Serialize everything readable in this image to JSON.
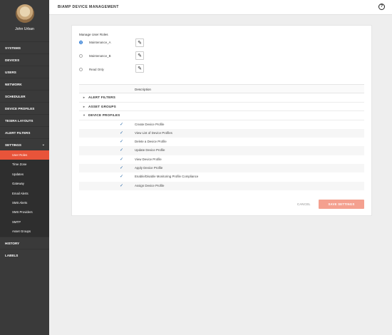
{
  "user": {
    "name": "John Urban"
  },
  "header": {
    "title": "BIAMP DEVICE MANAGEMENT",
    "help_glyph": "?"
  },
  "sidebar": {
    "items": [
      {
        "label": "SYSTEMS"
      },
      {
        "label": "DEVICES"
      },
      {
        "label": "USERS"
      },
      {
        "label": "NETWORK"
      },
      {
        "label": "SCHEDULER"
      },
      {
        "label": "DEVICE PROFILES"
      },
      {
        "label": "TESIRA LAYOUTS"
      },
      {
        "label": "ALERT FILTERS"
      },
      {
        "label": "SETTINGS",
        "expanded": true
      }
    ],
    "settings_sub": [
      {
        "label": "User Roles",
        "active": true
      },
      {
        "label": "Time Zone"
      },
      {
        "label": "Updates"
      },
      {
        "label": "Gateway"
      },
      {
        "label": "Email Alerts"
      },
      {
        "label": "SMS Alerts"
      },
      {
        "label": "SMS Providers"
      },
      {
        "label": "SMTP"
      },
      {
        "label": "Asset Groups"
      }
    ],
    "bottom_items": [
      {
        "label": "HISTORY"
      },
      {
        "label": "LABELS"
      }
    ]
  },
  "roles": {
    "title": "Manage User Roles",
    "items": [
      {
        "label": "Maintenance_A",
        "selected": true
      },
      {
        "label": "Maintenance_B",
        "selected": false
      },
      {
        "label": "Read Only",
        "selected": false
      }
    ]
  },
  "permissions": {
    "description_header": "Description",
    "groups": [
      {
        "label": "ALERT FILTERS",
        "expanded": false
      },
      {
        "label": "ASSET GROUPS",
        "expanded": false
      },
      {
        "label": "DEVICE PROFILES",
        "expanded": true
      }
    ],
    "rows": [
      {
        "label": "Create Device Profile",
        "checked": true
      },
      {
        "label": "View List of Device Profiles",
        "checked": true
      },
      {
        "label": "Delete a Device Profile",
        "checked": true
      },
      {
        "label": "Update Device Profile",
        "checked": true
      },
      {
        "label": "View Device Profile",
        "checked": true
      },
      {
        "label": "Apply Device Profile",
        "checked": true
      },
      {
        "label": "Enable/Disable Monitoring Profile Compliance",
        "checked": true
      },
      {
        "label": "Assign Device Profile",
        "checked": true
      }
    ]
  },
  "actions": {
    "cancel_label": "CANCEL",
    "save_label": "SAVE SETTINGS"
  },
  "colors": {
    "accent": "#e8543a",
    "sidebar": "#3a3a3a",
    "save_disabled": "#f4a08f",
    "check": "#2a6aa8"
  }
}
